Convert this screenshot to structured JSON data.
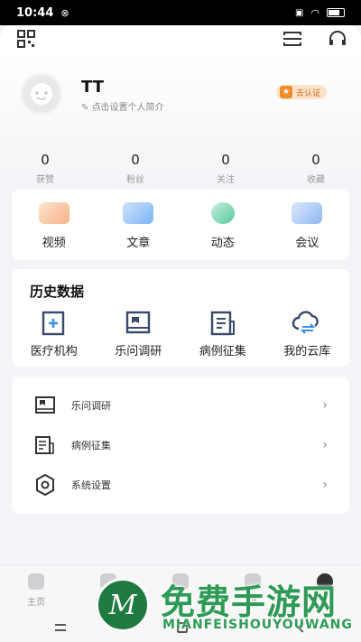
{
  "status_bar": {
    "time": "10:44"
  },
  "profile": {
    "username": "TT",
    "bio_placeholder": "点击设置个人简介",
    "cert_badge": "去认证"
  },
  "stats": [
    {
      "value": "0",
      "label": "获赞"
    },
    {
      "value": "0",
      "label": "粉丝"
    },
    {
      "value": "0",
      "label": "关注"
    },
    {
      "value": "0",
      "label": "收藏"
    }
  ],
  "quick_actions": [
    {
      "label": "视频",
      "icon": "video-icon",
      "color": "#f6b286"
    },
    {
      "label": "文章",
      "icon": "article-icon",
      "color": "#7cb4f5"
    },
    {
      "label": "动态",
      "icon": "moments-icon",
      "color": "#56c99b"
    },
    {
      "label": "会议",
      "icon": "meeting-icon",
      "color": "#8fb8f3"
    }
  ],
  "history": {
    "title": "历史数据",
    "items": [
      {
        "label": "医疗机构",
        "icon": "medical-institution-icon"
      },
      {
        "label": "乐问调研",
        "icon": "survey-book-icon"
      },
      {
        "label": "病例征集",
        "icon": "case-document-icon"
      },
      {
        "label": "我的云库",
        "icon": "cloud-sync-icon"
      }
    ]
  },
  "menu_list": [
    {
      "label": "乐问调研",
      "icon": "survey-book-icon",
      "chevron": "›"
    },
    {
      "label": "病例征集",
      "icon": "case-document-icon",
      "chevron": "›"
    },
    {
      "label": "系统设置",
      "icon": "gear-icon",
      "chevron": "›"
    }
  ],
  "bottom_nav": [
    {
      "label": "主页",
      "icon": "home-icon"
    },
    {
      "label": "",
      "icon": "discover-icon"
    },
    {
      "label": "",
      "icon": "contacts-icon"
    },
    {
      "label": "消",
      "icon": "message-icon"
    },
    {
      "label": "",
      "icon": "profile-icon"
    }
  ],
  "watermark": {
    "title": "免费手游网",
    "subtitle": "MIANFEISHOUYOUWANG",
    "logo_letter": "M"
  },
  "colors": {
    "accent": "#f08a2b",
    "watermark_green": "#2e9a55"
  }
}
